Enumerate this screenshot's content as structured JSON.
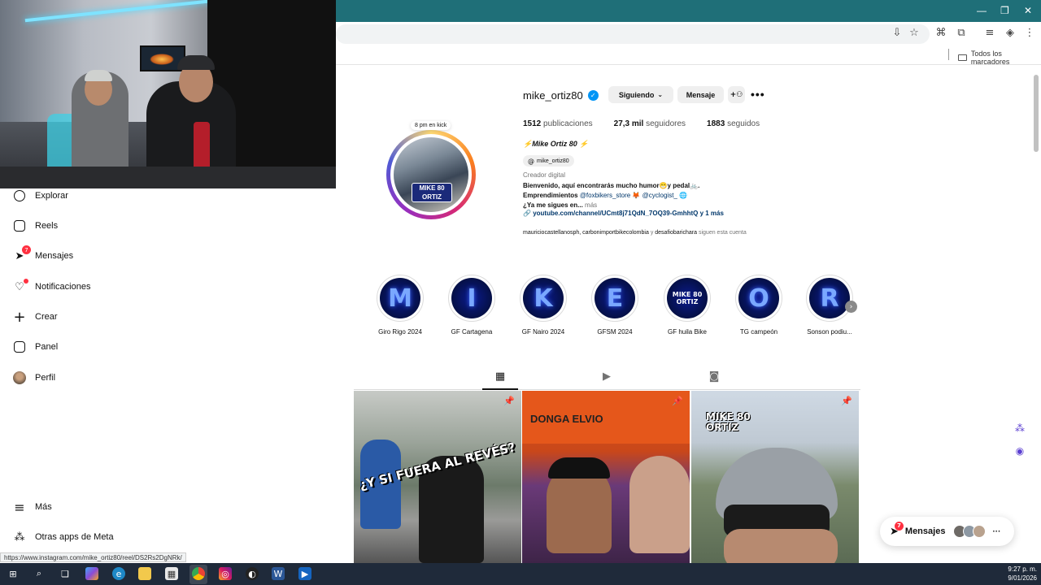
{
  "browser": {
    "bookmarks_label": "Todos los marcadores",
    "status_url": "https://www.instagram.com/mike_ortiz80/reel/DS2Rs2DgNRk/"
  },
  "nav": {
    "items": [
      {
        "name": "nav-explorar",
        "icon": "compass-icon",
        "label": "Explorar"
      },
      {
        "name": "nav-reels",
        "icon": "reels-icon",
        "label": "Reels"
      },
      {
        "name": "nav-mensajes",
        "icon": "messenger-icon",
        "label": "Mensajes",
        "badge": "7"
      },
      {
        "name": "nav-notificaciones",
        "icon": "heart-icon",
        "label": "Notificaciones"
      },
      {
        "name": "nav-crear",
        "icon": "plus-icon",
        "label": "Crear"
      },
      {
        "name": "nav-panel",
        "icon": "dashboard-icon",
        "label": "Panel"
      },
      {
        "name": "nav-perfil",
        "icon": "avatar-icon",
        "label": "Perfil"
      }
    ],
    "more_label": "Más",
    "meta_label": "Otras apps de Meta"
  },
  "profile": {
    "note": "8 pm en kick",
    "username": "mike_ortiz80",
    "following_btn": "Siguiendo",
    "message_btn": "Mensaje",
    "posts_count": "1512",
    "posts_label": "publicaciones",
    "followers_count": "27,3 mil",
    "followers_label": "seguidores",
    "following_count": "1883",
    "following_label": "seguidos",
    "full_name": "⚡Mike Ortiz 80 ⚡",
    "threads_handle": "mike_ortiz80",
    "category": "Creador digital",
    "bio_line1": "Bienvenido, aquí encontrarás mucho humor😁y pedal🚲.",
    "bio_line2_prefix": "Emprendimientos",
    "bio_tag1": "@foxbikers_store",
    "bio_tag2": "@cyclogist_",
    "bio_line3": "¿Ya me sigues en...",
    "bio_more": "más",
    "link_text": "youtube.com/channel/UCmt8j71QdN_7OQ39-GmhhtQ y 1 más",
    "followed_by_names": "mauriciocastellanosph, carbonimportbikecolombia",
    "followed_by_and": "y",
    "followed_by_last": "desafiobarichara",
    "followed_by_suffix": "siguen esta cuenta",
    "logo_text": "MIKE 80 ORTIZ"
  },
  "highlights": [
    {
      "letter": "M",
      "label": "Giro Rigo 2024"
    },
    {
      "letter": "I",
      "label": "GF Cartagena"
    },
    {
      "letter": "K",
      "label": "GF Nairo 2024"
    },
    {
      "letter": "E",
      "label": "GFSM 2024"
    },
    {
      "letter": "",
      "label": "GF huila Bike"
    },
    {
      "letter": "O",
      "label": "TG campeón"
    },
    {
      "letter": "R",
      "label": "Sonson podiu..."
    }
  ],
  "posts": [
    {
      "caption": "¿Y SI FUERA AL REVÉS?"
    },
    {
      "caption": "DONGA ELVIO"
    },
    {
      "caption": "MIKE 80 ORTIZ"
    }
  ],
  "messages_pill": {
    "label": "Mensajes",
    "badge": "7"
  },
  "taskbar": {
    "time": "9:27 p. m.",
    "date": "9/01/2026"
  }
}
